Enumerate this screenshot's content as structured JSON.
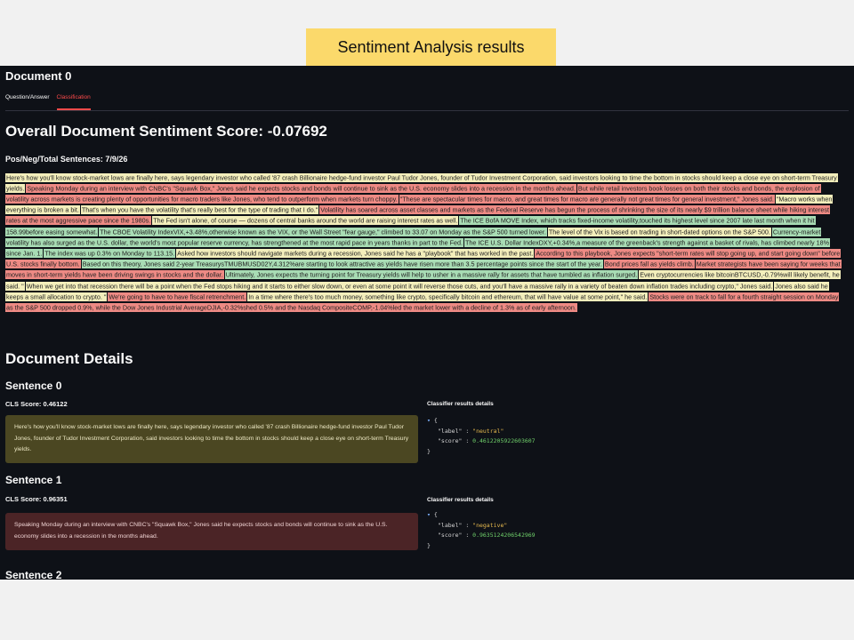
{
  "banner": "Sentiment Analysis results",
  "doc_title": "Document 0",
  "tabs": [
    "Question/Answer",
    "Classification"
  ],
  "overall": "Overall Document Sentiment Score: -0.07692",
  "counts": "Pos/Neg/Total Sentences: 7/9/26",
  "sentences": [
    {
      "text": "Here's how you'll know stock-market lows are finally here, says legendary investor who called '87 crash Billionaire hedge-fund investor Paul Tudor Jones, founder of Tudor Investment Corporation, said investors looking to time the bottom in stocks should keep a close eye on short-term Treasury yields.",
      "label": "neutral"
    },
    {
      "text": "Speaking Monday during an interview with CNBC's \"Squawk Box,\" Jones said he expects stocks and bonds will continue to sink as the U.S. economy slides into a recession in the months ahead.",
      "label": "negative"
    },
    {
      "text": "But while retail investors book losses on both their stocks and bonds, the explosion of volatility across markets is creating plenty of opportunities for macro traders like Jones, who tend to outperform when markets turn choppy.",
      "label": "negative"
    },
    {
      "text": "\"These are spectacular times for macro, and great times for macro are generally not great times for general investment,\" Jones said.",
      "label": "negative"
    },
    {
      "text": "\"Macro works when everything is broken a bit.",
      "label": "neutral"
    },
    {
      "text": "That's when you have the volatility that's really best for the type of trading that I do.\"",
      "label": "neutral"
    },
    {
      "text": "Volatility has soared across asset classes and markets as the Federal Reserve has begun the process of shrinking the size of its nearly $9 trillion balance sheet while hiking interest rates at the most aggressive pace since the 1980s.",
      "label": "negative"
    },
    {
      "text": "The Fed isn't alone, of course — dozens of central banks around the world are raising interest rates as well.",
      "label": "neutral"
    },
    {
      "text": "The ICE BofA MOVE Index, which tracks fixed-income volatility,touched its highest level since 2007 late last month when it hit 158.99before easing somewhat.",
      "label": "positive"
    },
    {
      "text": "The CBOE Volatility IndexVIX,+3.48%,otherwise known as the VIX, or the Wall Street \"fear gauge,\" climbed to 33.07 on Monday as the S&P 500 turned lower.",
      "label": "positive"
    },
    {
      "text": "The level of the Vix is based on trading in short-dated options on the S&P 500.",
      "label": "neutral"
    },
    {
      "text": "Currency-market volatility has also surged as the U.S. dollar, the world's most popular reserve currency, has strengthened at the most rapid pace in years thanks in part to the Fed.",
      "label": "positive"
    },
    {
      "text": "The ICE U.S. Dollar IndexDXY,+0.34%,a measure of the greenback's strength against a basket of rivals, has climbed nearly 18% since Jan. 1.",
      "label": "positive"
    },
    {
      "text": "The index was up 0.3% on Monday to 113.15.",
      "label": "positive"
    },
    {
      "text": "Asked how investors should navigate markets during a recession, Jones said he has a \"playbook\" that has worked in the past.",
      "label": "neutral"
    },
    {
      "text": "According to this playbook, Jones expects \"short-term rates will stop going up, and start going down\" before U.S. stocks finally bottom.",
      "label": "negative"
    },
    {
      "text": "Based on this theory, Jones said 2-year TreasurysTMUBMUSD02Y,4.312%are starting to look attractive as yields have risen more than 3.5 percentage points since the start of the year.",
      "label": "positive"
    },
    {
      "text": "Bond prices fall as yields climb.",
      "label": "negative"
    },
    {
      "text": "Market strategists have been saying for weeks that moves in short-term yields have been driving swings in stocks and the dollar.",
      "label": "negative"
    },
    {
      "text": "Ultimately, Jones expects the turning point for Treasury yields will help to usher in a massive rally for assets that have tumbled as inflation surged.",
      "label": "positive"
    },
    {
      "text": "Even cryptocurrencies like bitcoinBTCUSD,-0.79%will likely benefit, he said. \"",
      "label": "neutral"
    },
    {
      "text": "When we get into that recession there will be a point when the Fed stops hiking and it starts to either slow down, or even at some point it will reverse those cuts, and you'll have a massive rally in a variety of beaten down inflation trades including crypto,\" Jones said.",
      "label": "neutral"
    },
    {
      "text": "Jones also said he keeps a small allocation to crypto. \"",
      "label": "neutral"
    },
    {
      "text": "We're going to have to have fiscal retrenchment.",
      "label": "negative"
    },
    {
      "text": "In a time where there's too much money, something like crypto, specifically bitcoin and ethereum, that will have value at some point,\" he said.",
      "label": "neutral"
    },
    {
      "text": "Stocks were on track to fall for a fourth straight session on Monday as the S&P 500 dropped 0.9%, while the Dow Jones Industrial AverageDJIA,-0.32%shed 0.5% and the Nasdaq CompositeCOMP,-1.04%led the market lower with a decline of 1.3% as of early afternoon.",
      "label": "negative"
    }
  ],
  "details_title": "Document Details",
  "details": [
    {
      "heading": "Sentence 0",
      "cls": "CLS Score: 0.46122",
      "text": "Here's how you'll know stock-market lows are finally here, says legendary investor who called '87 crash Billionaire hedge-fund investor Paul Tudor Jones, founder of Tudor Investment Corporation, said investors looking to time the bottom in stocks should keep a close eye on short-term Treasury yields.",
      "label": "neutral",
      "label_str": "\"neutral\"",
      "score": "0.4612205922603607"
    },
    {
      "heading": "Sentence 1",
      "cls": "CLS Score: 0.96351",
      "text": "Speaking Monday during an interview with CNBC's \"Squawk Box,\" Jones said he expects stocks and bonds will continue to sink as the U.S. economy slides into a recession in the months ahead.",
      "label": "negative",
      "label_str": "\"negative\"",
      "score": "0.9635124206542969"
    }
  ],
  "details_next": "Sentence 2",
  "classifier_title": "Classifier results details",
  "json_keys": {
    "label": "\"label\"",
    "score": "\"score\""
  },
  "colors": {
    "neutral": "#f3eebb",
    "negative": "#ee8a84",
    "positive": "#a8dcb4",
    "accent": "#ff4b4b",
    "banner": "#fbd96b"
  }
}
